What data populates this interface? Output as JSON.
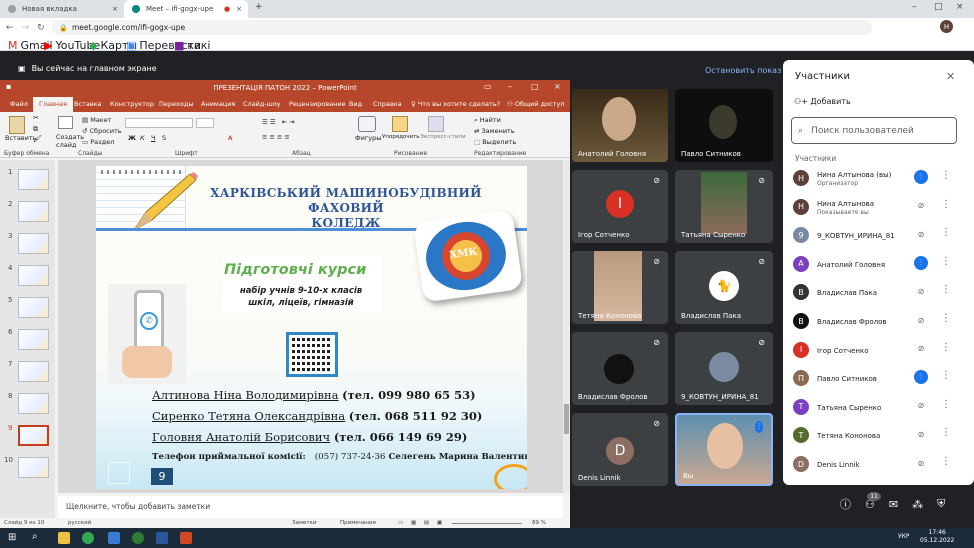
{
  "browser": {
    "tabs": [
      {
        "title": "Новая вкладка"
      },
      {
        "title": "Meet – ifi-gogx-upe"
      }
    ],
    "url": "meet.google.com/ifi-gogx-upe",
    "bookmarks": [
      "Gmail",
      "YouTube",
      "Карты",
      "Перевести",
      "какі"
    ]
  },
  "meet": {
    "banner": "Вы сейчас на главном экране",
    "stop_presenting": "Остановить показ",
    "tiles": [
      {
        "name": "Анатолий Головня"
      },
      {
        "name": "Павло Ситников"
      },
      {
        "name": "Ігор Сотченко",
        "initial": "I"
      },
      {
        "name": "Татьяна Сыренко"
      },
      {
        "name": "Тетяна Кононова"
      },
      {
        "name": "Владислав Пака"
      },
      {
        "name": "Владислав Фролов"
      },
      {
        "name": "9_КОВТУН_ИРИНА_81"
      },
      {
        "name": "Denis Linnik",
        "initial": "D"
      },
      {
        "name": "Вы"
      }
    ],
    "bottom_badge": "11",
    "clock": {
      "time": "17:46",
      "date": "05.12.2022",
      "lang": "УКР"
    }
  },
  "ppt": {
    "title": "ПРЕЗЕНТАЦІЯ ПАТОН 2022  –  PowerPoint",
    "tabs": [
      "Файл",
      "Главная",
      "Вставка",
      "Конструктор",
      "Переходы",
      "Анимация",
      "Слайд-шоу",
      "Рецензирование",
      "Вид",
      "Справка",
      "Что вы хотите сделать?",
      "Общий доступ"
    ],
    "ribbon": {
      "paste": "Вставить",
      "create": "Создать слайд",
      "layout": "Макет",
      "reset": "Сбросить",
      "section": "Раздел",
      "shapes": "Фигуры",
      "arrange": "Упорядочить",
      "styles": "Экспресс-стили",
      "find": "Найти",
      "replace": "Заменить",
      "select": "Выделить",
      "groups": [
        "Буфер обмена",
        "Слайды",
        "Шрифт",
        "Абзац",
        "Рисование",
        "Редактирование"
      ]
    },
    "thumb_numbers": [
      "1",
      "2",
      "3",
      "4",
      "5",
      "6",
      "7",
      "8",
      "9",
      "10"
    ],
    "notes_placeholder": "Щелкните, чтобы добавить заметки",
    "status": {
      "slide": "Слайд 9 из 10",
      "lang": "русский",
      "notes": "Заметки",
      "comments": "Примечания",
      "zoom": "89 %"
    }
  },
  "slide": {
    "heading_line1": "ХАРКІВСЬКИЙ МАШИНОБУДІВНИЙ ФАХОВИЙ",
    "heading_line2": "КОЛЕДЖ",
    "logo_text": "ХМК",
    "courses": "Підготовчі курси",
    "courses_sub": "набір учнів 9-10-х класів шкіл, ліцеїв, гімназій",
    "contacts": [
      {
        "name": "Алтинова Ніна Володимирівна",
        "phone": "(тел.  099 980 65 53)"
      },
      {
        "name": "Сиренко Тетяна Олександрівна",
        "phone": "(тел. 068 511 92 30)"
      },
      {
        "name": "Головня Анатолій Борисович",
        "phone": "(тел. 066 149 69 29)"
      }
    ],
    "admission_label": "Телефон приймальної комісії:",
    "admission_phone": "(057) 737-24-36",
    "admission_name": "Селегень Марина Валентинівна",
    "number": "9"
  },
  "participants": {
    "title": "Участники",
    "add": "Добавить",
    "search_placeholder": "Поиск пользователей",
    "section": "Участники",
    "list": [
      {
        "name": "Нина Алтынова (вы)",
        "sub": "Организатор",
        "initial": "Н",
        "color": "#5d4037",
        "mic": "on"
      },
      {
        "name": "Нина Алтынова",
        "sub": "Показываете вы",
        "initial": "Н",
        "color": "#5d4037",
        "mic": "off"
      },
      {
        "name": "9_КОВТУН_ИРИНА_81",
        "sub": "",
        "initial": "9",
        "color": "#7a8aa0",
        "mic": "off"
      },
      {
        "name": "Анатолий Головня",
        "sub": "",
        "initial": "А",
        "color": "#7b3fbf",
        "mic": "on"
      },
      {
        "name": "Владислав Пака",
        "sub": "",
        "initial": "В",
        "color": "#333333",
        "mic": "off"
      },
      {
        "name": "Владислав Фролов",
        "sub": "",
        "initial": "В",
        "color": "#111111",
        "mic": "off"
      },
      {
        "name": "Ігор Сотченко",
        "sub": "",
        "initial": "І",
        "color": "#d93025",
        "mic": "off"
      },
      {
        "name": "Павло Ситников",
        "sub": "",
        "initial": "П",
        "color": "#8a6a50",
        "mic": "on"
      },
      {
        "name": "Татьяна Сыренко",
        "sub": "",
        "initial": "Т",
        "color": "#7b3fbf",
        "mic": "off"
      },
      {
        "name": "Тетяна Кононова",
        "sub": "",
        "initial": "Т",
        "color": "#556b2f",
        "mic": "off"
      },
      {
        "name": "Denis Linnik",
        "sub": "",
        "initial": "D",
        "color": "#8d6e63",
        "mic": "off"
      }
    ]
  }
}
